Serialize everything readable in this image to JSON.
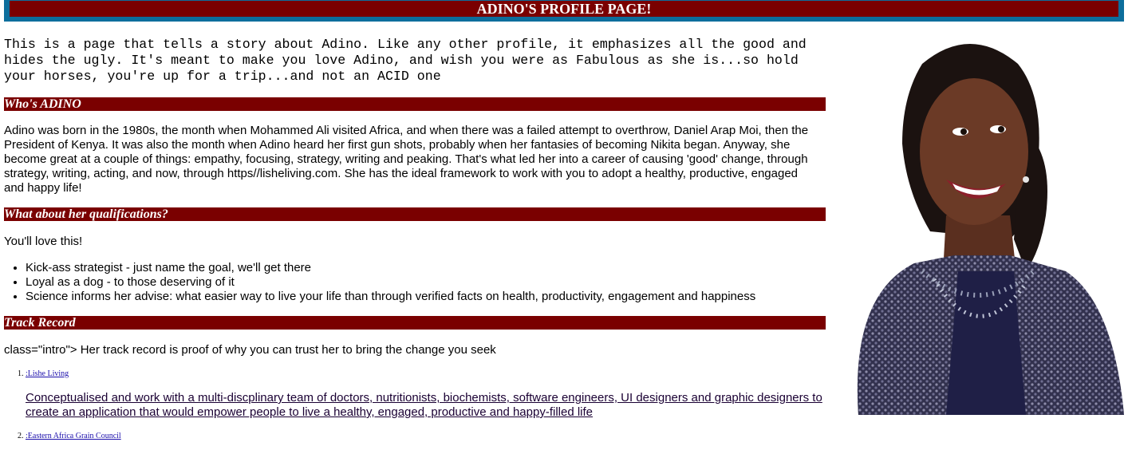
{
  "header": {
    "title": "ADINO'S PROFILE PAGE!"
  },
  "intro": "This is a page that tells a story about Adino. Like any other profile, it emphasizes all the good and hides the ugly. It's meant to make you love Adino, and wish you were as Fabulous as she is...so hold your horses, you're up for a trip...and not an ACID one",
  "sections": {
    "who": {
      "heading": "Who's ADINO",
      "body": "Adino was born in the 1980s, the month when Mohammed Ali visited Africa, and when there was a failed attempt to overthrow, Daniel Arap Moi, then the President of Kenya. It was also the month when Adino heard her first gun shots, probably when her fantasies of becoming Nikita began. Anyway, she become great at a couple of things: empathy, focusing, strategy, writing and peaking. That's what led her into a career of causing 'good' change, through strategy, writing, acting, and now, through https//lisheliving.com. She has the ideal framework to work with you to adopt a healthy, productive, engaged and happy life!"
    },
    "qualifications": {
      "heading": "What about her qualifications?",
      "lead": "You'll love this!",
      "items": [
        "Kick-ass strategist - just name the goal, we'll get there",
        "Loyal as a dog - to those deserving of it",
        "Science informs her advise: what easier way to live your life than through verified facts on health, productivity, engagement and happiness"
      ]
    },
    "track": {
      "heading": "Track Record",
      "lead": "class=\"intro\"> Her track record is proof of why you can trust her to bring the change you seek",
      "items": [
        {
          "company": ":Lishe Living",
          "description": "Conceptualised and work with a multi-discplinary team of doctors, nutritionists, biochemists, software engineers, UI designers and graphic designers to create an application that would empower people to live a healthy, engaged, productive and happy-filled life"
        },
        {
          "company": ":Eastern Africa Grain Council",
          "description": ""
        }
      ]
    }
  },
  "colors": {
    "heading_bg": "#7a0000",
    "topbar_bg": "#0d6e9c",
    "link": "#1a0dab"
  }
}
